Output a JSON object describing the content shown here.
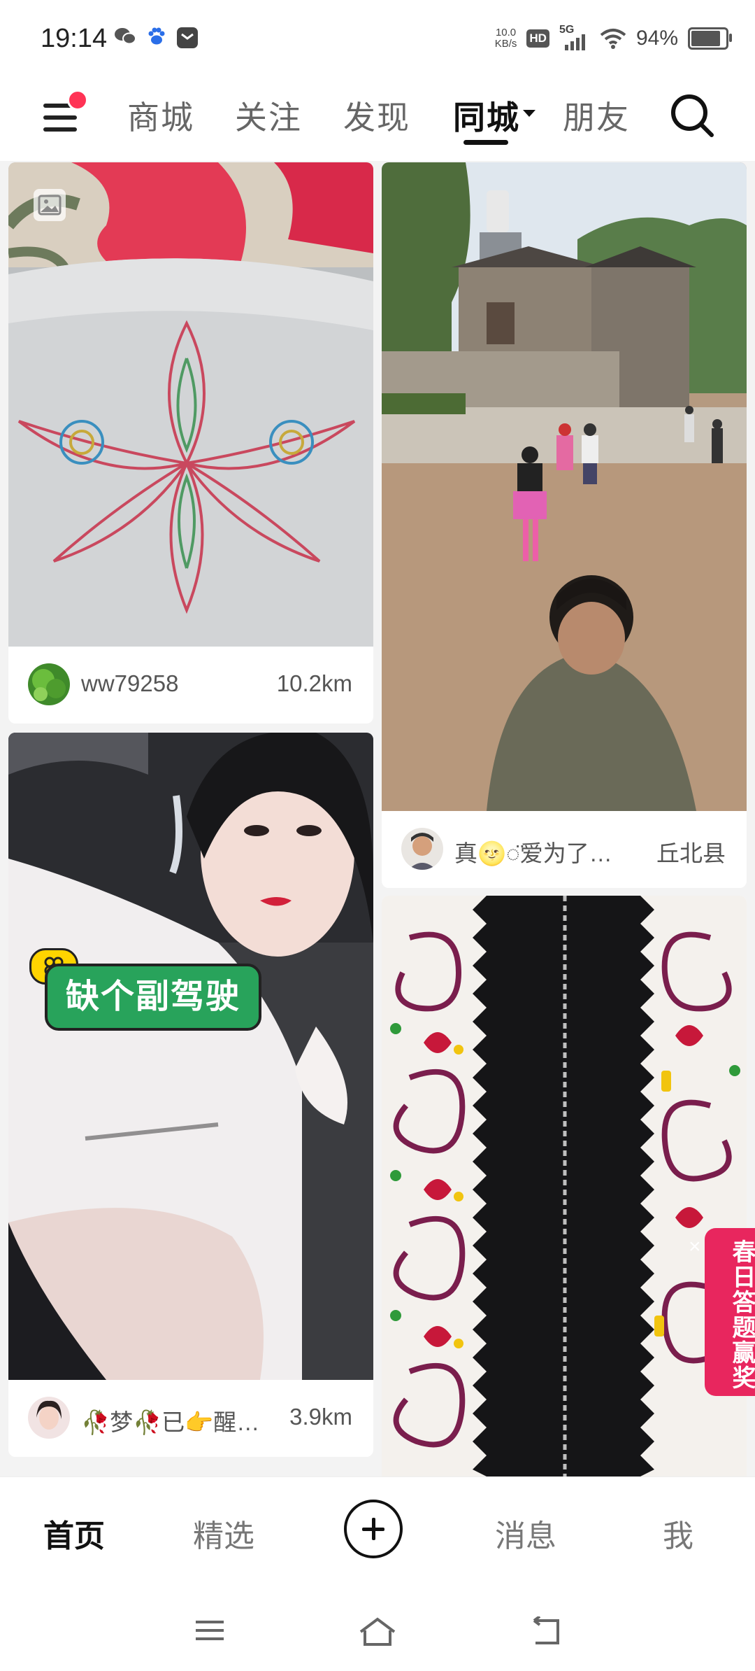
{
  "status_bar": {
    "time": "19:14",
    "net_speed_value": "10.0",
    "net_speed_unit": "KB/s",
    "hd_label": "HD",
    "signal_label": "5G",
    "battery_text": "94%",
    "battery_level": 0.94,
    "icons": [
      "wechat-icon",
      "baidu-icon",
      "message-icon",
      "hd-icon",
      "signal-icon",
      "wifi-icon",
      "battery-icon"
    ]
  },
  "top_nav": {
    "tabs": [
      {
        "label": "商城"
      },
      {
        "label": "关注"
      },
      {
        "label": "发现"
      },
      {
        "label": "同城"
      },
      {
        "label": "朋友"
      }
    ],
    "active_tab": "同城"
  },
  "feed": {
    "cards": [
      {
        "author": "ww79258",
        "distance": "10.2km",
        "media_type": "image"
      },
      {
        "author": "真🌝◌̈爱为了…",
        "distance": "丘北县",
        "media_type": "video"
      },
      {
        "author": "🥀梦🥀已👉醒…",
        "distance": "3.9km",
        "media_type": "video",
        "tag": "缺个副驾驶"
      },
      {
        "author": "",
        "distance": "",
        "media_type": "video"
      }
    ]
  },
  "floating_banner": {
    "text": "春日答题赢奖",
    "close": "×"
  },
  "bottom_nav": {
    "items": [
      {
        "label": "首页"
      },
      {
        "label": "精选"
      },
      {
        "label": "消息"
      },
      {
        "label": "我"
      }
    ],
    "active": "首页"
  },
  "colors": {
    "accent_red": "#ff3355",
    "tag_green": "#28a35b",
    "banner_pink": "#e8265e"
  }
}
